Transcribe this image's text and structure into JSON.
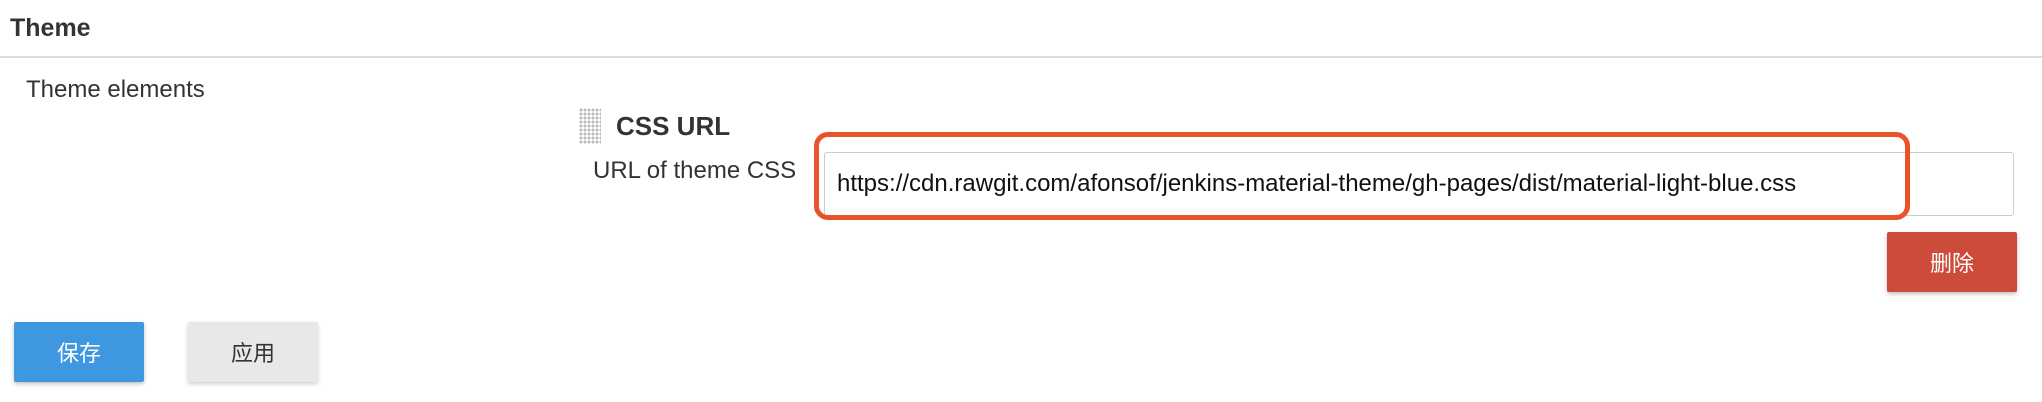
{
  "section": {
    "title": "Theme",
    "elements_label": "Theme elements"
  },
  "css_url_block": {
    "heading": "CSS URL",
    "field_label": "URL of theme CSS",
    "field_value": "https://cdn.rawgit.com/afonsof/jenkins-material-theme/gh-pages/dist/material-light-blue.css",
    "delete_label": "删除"
  },
  "actions": {
    "save_label": "保存",
    "apply_label": "应用"
  },
  "colors": {
    "highlight": "#e8532c",
    "delete_button": "#cc4b3a",
    "save_button": "#3f97e2",
    "apply_button": "#e8e8e8"
  },
  "icons": {
    "drag_handle": "drag-handle-icon"
  }
}
